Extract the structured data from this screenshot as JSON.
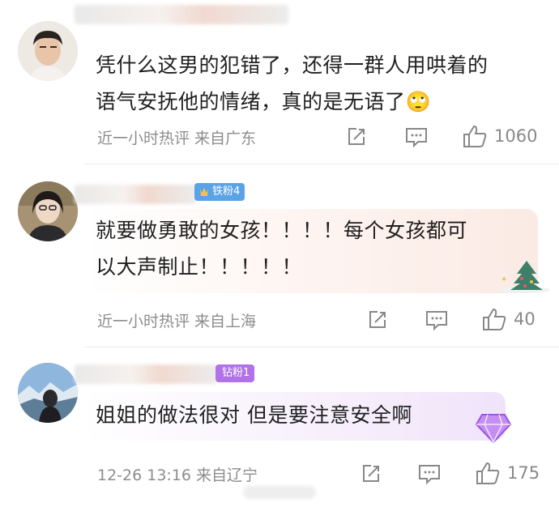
{
  "comments": [
    {
      "text_line1": "凭什么这男的犯错了，还得一群人用哄着的",
      "text_line2": "语气安抚他的情绪，真的是无语了🙄",
      "meta": "近一小时热评  来自广东",
      "likes": "1060"
    },
    {
      "badge": "铁粉4",
      "text_line1": "就要做勇敢的女孩！！！！每个女孩都可",
      "text_line2": "以大声制止！！！！！",
      "meta": "近一小时热评  来自上海",
      "likes": "40"
    },
    {
      "badge": "钻粉1",
      "text_line1": "姐姐的做法很对  但是要注意安全啊",
      "meta": "12-26 13:16  来自辽宁",
      "likes": "175"
    }
  ],
  "colors": {
    "iron_badge": "#5aa3e6",
    "diamond_badge": "#b072e6",
    "meta_text": "#8d8d8d"
  }
}
